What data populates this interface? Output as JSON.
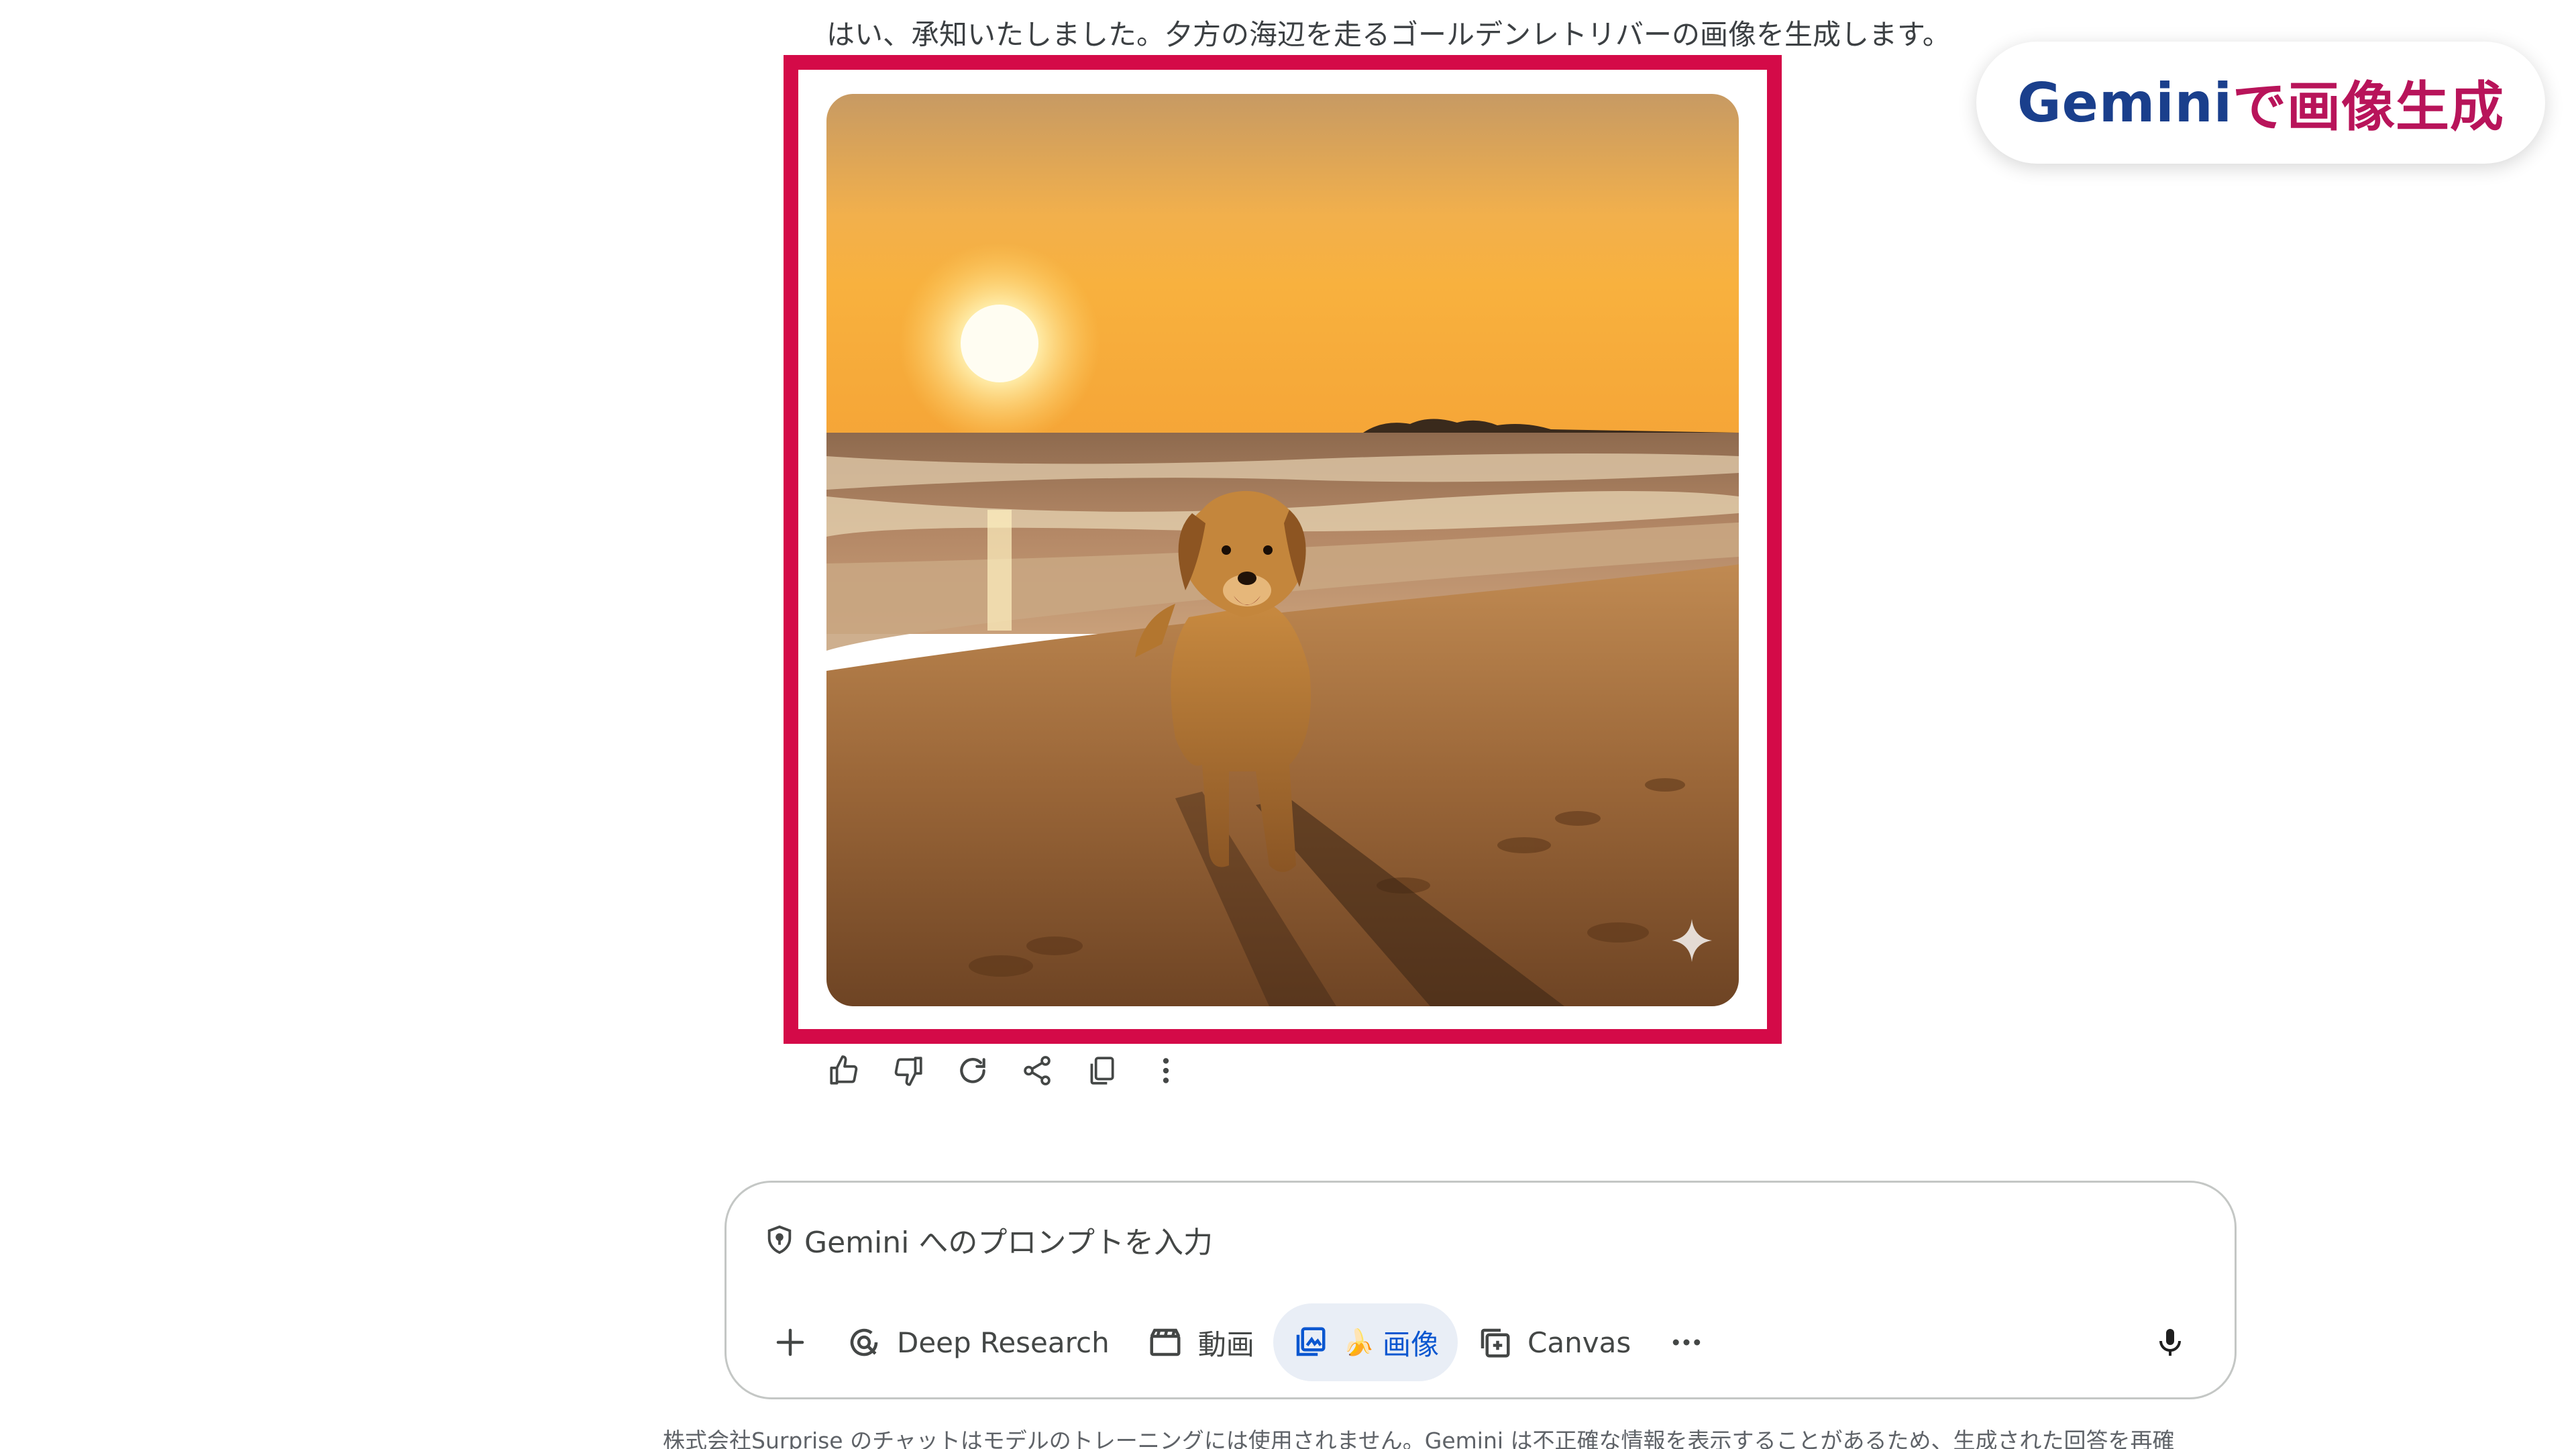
{
  "chat": {
    "response_text": "はい、承知いたしました。夕方の海辺を走るゴールデンレトリバーの画像を生成します。"
  },
  "badge": {
    "part1": "Gemini",
    "part2": "で画像生成"
  },
  "image_actions": [
    {
      "icon": "thumbs-up-icon"
    },
    {
      "icon": "thumbs-down-icon"
    },
    {
      "icon": "regenerate-icon"
    },
    {
      "icon": "share-icon"
    },
    {
      "icon": "copy-icon"
    },
    {
      "icon": "more-vert-icon"
    }
  ],
  "prompt": {
    "placeholder": "Gemini へのプロンプトを入力"
  },
  "toolbar": {
    "deep_research": "Deep Research",
    "video": "動画",
    "image_emoji": "🍌",
    "image": "画像",
    "canvas": "Canvas"
  },
  "disclaimer": "株式会社Surprise のチャットはモデルのトレーニングには使用されません。Gemini は不正確な情報を表示することがあるため、生成された回答を再確",
  "colors": {
    "highlight": "#d40a48",
    "badge_blue": "#1a3f8c",
    "badge_magenta": "#b8145a",
    "active_tool_bg": "#e9eef6",
    "active_tool_text": "#0b57d0"
  }
}
